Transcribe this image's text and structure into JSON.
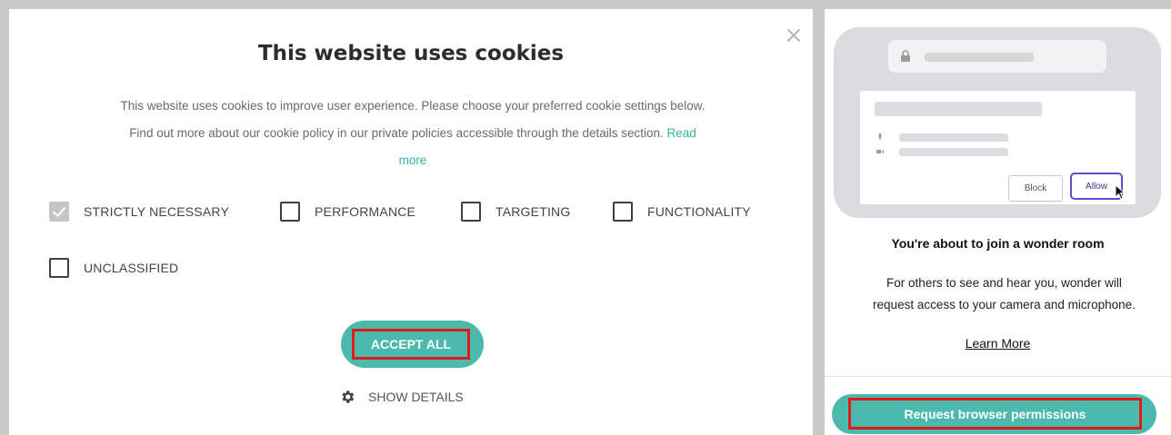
{
  "cookie_dialog": {
    "close_icon": "×",
    "title": "This website uses cookies",
    "description_line1": "This website uses cookies to improve user experience. Please choose your preferred cookie settings below.",
    "description_line2": "Find out more about our cookie policy in our private policies accessible through the details section.",
    "read": "Read",
    "more": "more",
    "categories": [
      {
        "label": "STRICTLY NECESSARY",
        "checked": true
      },
      {
        "label": "PERFORMANCE",
        "checked": false
      },
      {
        "label": "TARGETING",
        "checked": false
      },
      {
        "label": "FUNCTIONALITY",
        "checked": false
      },
      {
        "label": "UNCLASSIFIED",
        "checked": false
      }
    ],
    "accept_all_label": "ACCEPT ALL",
    "show_details_label": "SHOW DETAILS",
    "show_details_icon": "gear-icon"
  },
  "permission_panel": {
    "mock_block_label": "Block",
    "mock_allow_label": "Allow",
    "title": "You're about to join a wonder room",
    "description_line1": "For others to see and hear you, wonder will",
    "description_line2": "request access to your camera and microphone.",
    "learn_more_label": "Learn More",
    "request_button_label": "Request browser permissions"
  },
  "colors": {
    "accent_teal": "#4bb9ac",
    "highlight_red": "#e01b1b",
    "link_teal": "#35b3a6"
  }
}
